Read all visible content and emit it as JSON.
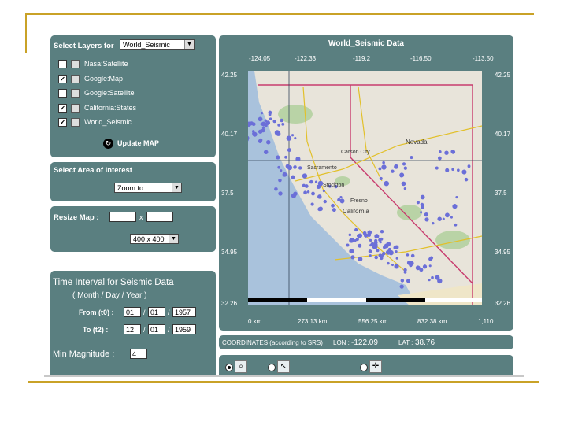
{
  "layers_panel": {
    "title": "Select Layers for",
    "dataset": "World_Seismic",
    "layers": [
      {
        "label": "Nasa:Satellite",
        "checked": false
      },
      {
        "label": "Google:Map",
        "checked": true
      },
      {
        "label": "Google:Satellite",
        "checked": false
      },
      {
        "label": "California:States",
        "checked": true
      },
      {
        "label": "World_Seismic",
        "checked": true
      }
    ],
    "update_label": "Update MAP"
  },
  "area_panel": {
    "title": "Select Area of Interest",
    "zoom_value": "Zoom to ..."
  },
  "resize_panel": {
    "title": "Resize Map :",
    "times": "x",
    "size_value": "400 x 400"
  },
  "time_panel": {
    "title": "Time Interval for Seismic Data",
    "subtitle": "( Month / Day / Year )",
    "from_label": "From (t0) :",
    "from_month": "01",
    "from_day": "01",
    "from_year": "1957",
    "to_label": "To (t2) :",
    "to_month": "12",
    "to_day": "01",
    "to_year": "1959",
    "slash": "/",
    "min_mag_label": "Min Magnitude :",
    "min_mag_value": "4"
  },
  "map_panel": {
    "title": "World_Seismic Data",
    "lon_ticks": [
      "-124.05",
      "-122.33",
      "-119.2",
      "-116.50",
      "-113.50"
    ],
    "lat_ticks_left": [
      "42.25",
      "40.17",
      "37.5",
      "34.95",
      "32.26"
    ],
    "lat_ticks_right": [
      "42.25",
      "40.17",
      "37.5",
      "34.95",
      "32.26"
    ],
    "scale_labels": [
      "0 km",
      "273.13 km",
      "556.25 km",
      "832.38 km",
      "1,110"
    ],
    "place_labels": [
      "Nevada",
      "California",
      "Sacramento",
      "Stockton",
      "Fresno",
      "Carson City"
    ]
  },
  "coords": {
    "label": "COORDINATES (according to SRS)",
    "lon_label": "LON :",
    "lon_value": "-122.09",
    "lat_label": "LAT :",
    "lat_value": "38.76"
  },
  "colors": {
    "panel": "#5a7f80",
    "frame": "#c9a227",
    "quake": "#6b6fd8"
  }
}
